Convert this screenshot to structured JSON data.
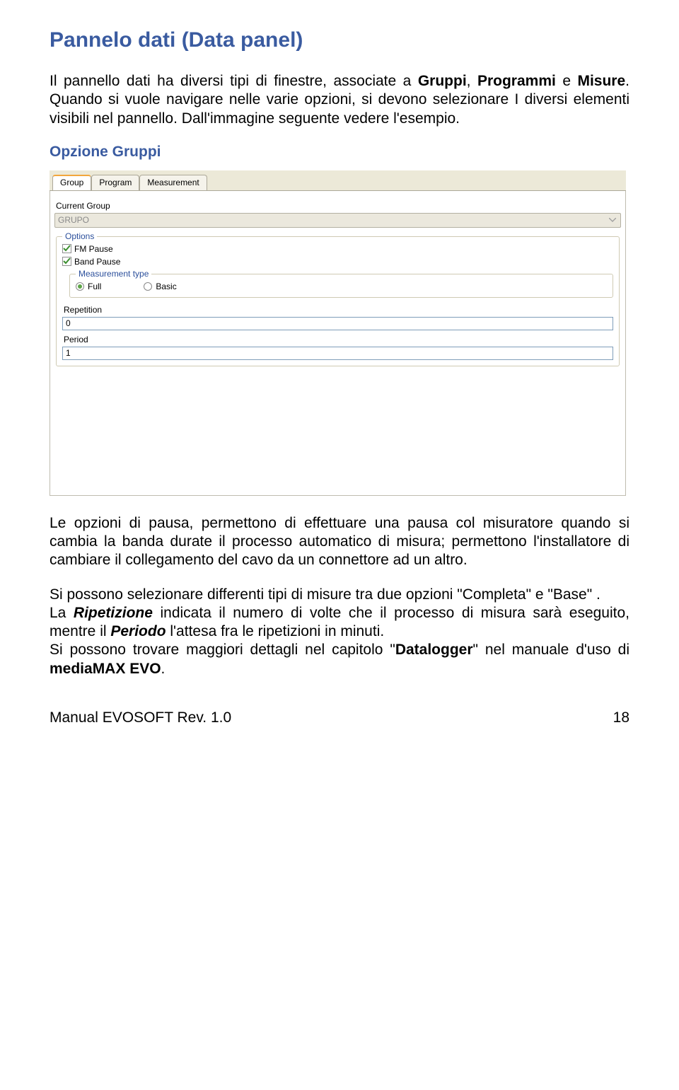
{
  "heading": "Pannelo dati (Data panel)",
  "intro_parts": {
    "p1": "Il pannello dati ha diversi tipi di finestre, associate a ",
    "b1": "Gruppi",
    "p2": ", ",
    "b2": "Programmi",
    "p3": " e ",
    "b3": "Misure",
    "p4": ". Quando si vuole navigare nelle varie opzioni, si devono selezionare I diversi elementi visibili nel pannello. Dall'immagine seguente vedere l'esempio."
  },
  "opzione_title": "Opzione Gruppi",
  "screenshot_ui": {
    "tabs": {
      "group": "Group",
      "program": "Program",
      "measurement": "Measurement"
    },
    "current_group_label": "Current Group",
    "current_group_value": "GRUPO",
    "options_title": "Options",
    "fm_pause": "FM Pause",
    "band_pause": "Band Pause",
    "measurement_type_title": "Measurement type",
    "radio_full": "Full",
    "radio_basic": "Basic",
    "repetition_label": "Repetition",
    "repetition_value": "0",
    "period_label": "Period",
    "period_value": "1"
  },
  "body": {
    "p1": "Le opzioni di pausa, permettono di effettuare una pausa col misuratore quando si cambia la banda durate il processo automatico di misura; permettono l'installatore di cambiare il collegamento del cavo da un connettore ad un altro.",
    "p2": "Si possono selezionare differenti tipi di misure tra due opzioni \"Completa\" e \"Base\" .",
    "p3a": "La ",
    "p3_rip": "Ripetizione",
    "p3b": " indicata il numero di volte che il processo di misura sarà eseguito, mentre il ",
    "p3_per": "Periodo",
    "p3c": " l'attesa fra le ripetizioni in minuti.",
    "p4a": "Si possono trovare maggiori dettagli nel capitolo \"",
    "p4_dl": "Datalogger",
    "p4b": "\" nel manuale d'uso di ",
    "p4_mm": "mediaMAX EVO",
    "p4c": "."
  },
  "footer_left": "Manual EVOSOFT Rev. 1.0",
  "footer_right": "18"
}
